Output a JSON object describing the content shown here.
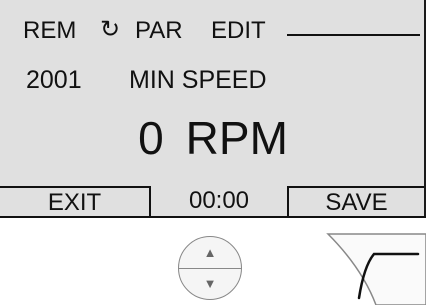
{
  "status_bar": {
    "mode": "REM",
    "rotation_symbol": "↻",
    "menu": "PAR",
    "state": "EDIT"
  },
  "parameter": {
    "id": "2001",
    "name": "MIN SPEED"
  },
  "value": {
    "number": "0",
    "unit": "RPM"
  },
  "softkeys": {
    "left": "EXIT",
    "clock": "00:00",
    "right": "SAVE"
  },
  "icons": {
    "up": "up-arrow-icon",
    "down": "down-arrow-icon",
    "softkey": "softkey-icon"
  },
  "colors": {
    "lcd_background": "#e0e0e0",
    "text": "#111111"
  }
}
